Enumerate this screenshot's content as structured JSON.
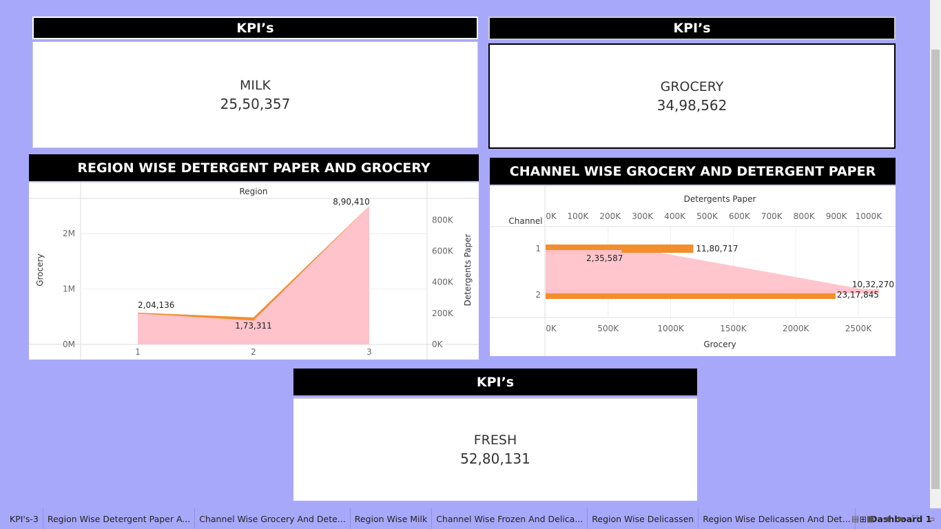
{
  "kpi_header": "KPI’s",
  "kpis": {
    "milk": {
      "label": "MILK",
      "value": "25,50,357"
    },
    "grocery": {
      "label": "GROCERY",
      "value": "34,98,562"
    },
    "fresh": {
      "label": "FRESH",
      "value": "52,80,131"
    }
  },
  "region_chart": {
    "title": "REGION WISE DETERGENT PAPER AND GROCERY",
    "top_label": "Region",
    "y_left_label": "Grocery",
    "y_right_label": "Detergents Paper",
    "y_left_ticks": [
      "2M",
      "1M",
      "0M"
    ],
    "y_right_ticks": [
      "800K",
      "600K",
      "400K",
      "200K",
      "0K"
    ],
    "x_ticks": [
      "1",
      "2",
      "3"
    ],
    "data_labels": [
      "2,04,136",
      "1,73,311",
      "8,90,410"
    ]
  },
  "channel_chart": {
    "title": "CHANNEL WISE GROCERY AND DETERGENT PAPER",
    "top_label": "Detergents Paper",
    "row_header": "Channel",
    "bottom_label": "Grocery",
    "top_ticks": [
      "0K",
      "100K",
      "200K",
      "300K",
      "400K",
      "500K",
      "600K",
      "700K",
      "800K",
      "900K",
      "1000K"
    ],
    "bottom_ticks": [
      "0K",
      "500K",
      "1000K",
      "1500K",
      "2000K",
      "2500K"
    ],
    "rows": [
      "1",
      "2"
    ],
    "data_labels": [
      "11,80,717",
      "2,35,587",
      "10,32,270",
      "23,17,845"
    ]
  },
  "chart_data": [
    {
      "type": "area",
      "title": "REGION WISE DETERGENT PAPER AND GROCERY",
      "xlabel": "Region",
      "categories": [
        "1",
        "2",
        "3"
      ],
      "series": [
        {
          "name": "Grocery",
          "axis": "left",
          "values": [
            560000,
            430000,
            2500000
          ],
          "color": "#f28e2b"
        },
        {
          "name": "Detergents Paper",
          "axis": "right",
          "values": [
            204136,
            173311,
            890410
          ],
          "color": "#ffc0c8"
        }
      ],
      "ylim_left": [
        0,
        2500000
      ],
      "ylim_right": [
        0,
        890410
      ]
    },
    {
      "type": "bar",
      "title": "CHANNEL WISE GROCERY AND DETERGENT PAPER",
      "categories": [
        "1",
        "2"
      ],
      "series": [
        {
          "name": "Detergents Paper",
          "values": [
            235587,
            1032270
          ],
          "color": "#ffc0c8"
        },
        {
          "name": "Grocery",
          "values": [
            1180717,
            2317845
          ],
          "color": "#f28e2b"
        }
      ],
      "xlim_top": [
        0,
        1000000
      ],
      "xlim_bottom": [
        0,
        2500000
      ]
    }
  ],
  "tabs": [
    {
      "label": "KPI's-3"
    },
    {
      "label": "Region Wise Detergent Paper A..."
    },
    {
      "label": "Channel Wise Grocery And Dete..."
    },
    {
      "label": "Region Wise Milk"
    },
    {
      "label": "Channel Wise Frozen And Delica..."
    },
    {
      "label": "Region Wise Delicassen"
    },
    {
      "label": "Region Wise Delicassen And Det..."
    },
    {
      "label": "Dashboard 1",
      "active": true
    }
  ],
  "colors": {
    "background": "#a8a8fa",
    "orange": "#f28e2b",
    "pink": "#ffc0c8",
    "header": "#000000"
  }
}
